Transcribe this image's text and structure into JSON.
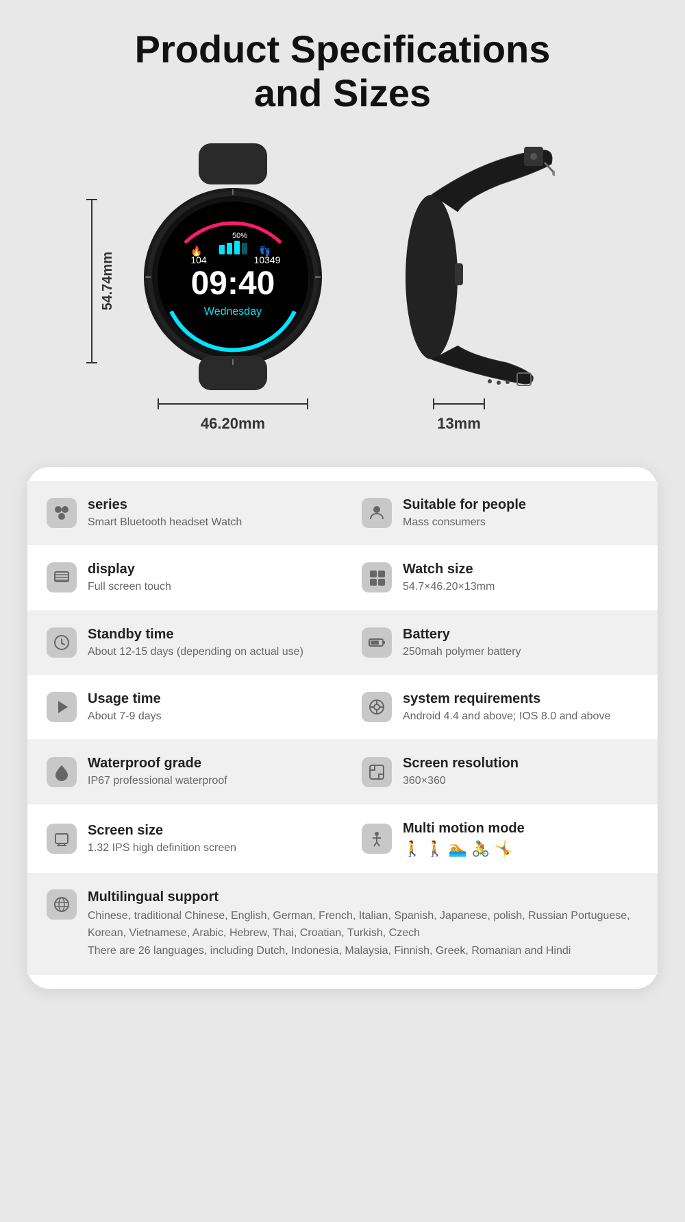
{
  "title": {
    "line1": "Product Specifications",
    "line2": "and Sizes"
  },
  "dimensions": {
    "height": "54.74mm",
    "width": "46.20mm",
    "thickness": "13mm"
  },
  "specs": {
    "row1": {
      "left": {
        "icon": "⬡",
        "label": "series",
        "value": "Smart Bluetooth headset Watch"
      },
      "right": {
        "icon": "👤",
        "label": "Suitable for people",
        "value": "Mass consumers"
      }
    },
    "row2": {
      "left": {
        "icon": "▤",
        "label": "display",
        "value": "Full screen touch"
      },
      "right": {
        "icon": "⬛",
        "label": "Watch size",
        "value": "54.7×46.20×13mm"
      }
    },
    "row3": {
      "left": {
        "icon": "⟳",
        "label": "Standby time",
        "value": "About 12-15 days (depending on actual use)"
      },
      "right": {
        "icon": "🔋",
        "label": "Battery",
        "value": "250mah polymer battery"
      }
    },
    "row4": {
      "left": {
        "icon": "⚡",
        "label": "Usage time",
        "value": "About 7-9 days"
      },
      "right": {
        "icon": "⚙",
        "label": "system requirements",
        "value": "Android 4.4 and above; IOS 8.0 and above"
      }
    },
    "row5": {
      "left": {
        "icon": "💧",
        "label": "Waterproof grade",
        "value": "IP67 professional waterproof"
      },
      "right": {
        "icon": "⤢",
        "label": "Screen resolution",
        "value": "360×360"
      }
    },
    "row6": {
      "left": {
        "icon": "📱",
        "label": "Screen size",
        "value": "1.32 IPS high definition screen"
      },
      "right": {
        "icon": "🏃",
        "label": "Multi motion mode",
        "icons": [
          "🚶",
          "🚶",
          "🏊",
          "🚴",
          "🤸"
        ]
      }
    },
    "row7": {
      "icon": "🌐",
      "label": "Multilingual support",
      "value": "Chinese, traditional Chinese, English, German, French, Italian, Spanish, Japanese, polish, Russian Portuguese, Korean, Vietnamese, Arabic, Hebrew, Thai, Croatian, Turkish, Czech\nThere are 26 languages, including Dutch, Indonesia, Malaysia, Finnish, Greek, Romanian and Hindi"
    }
  }
}
